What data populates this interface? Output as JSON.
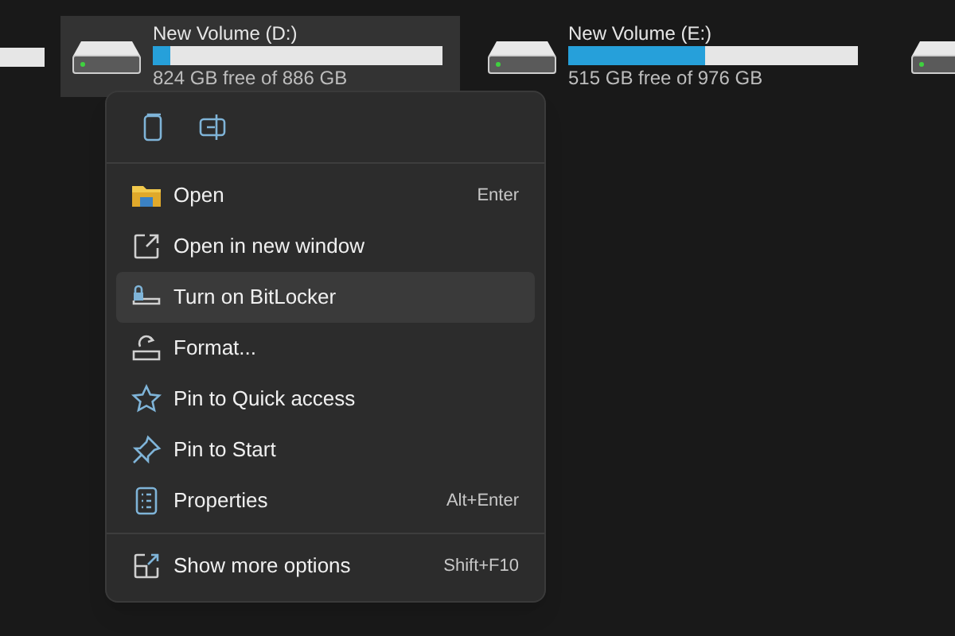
{
  "drives": [
    {
      "name": "New Volume (D:)",
      "free": "824 GB free of 886 GB",
      "level": 0.06,
      "selected": true
    },
    {
      "name": "New Volume (E:)",
      "free": "515 GB free of 976 GB",
      "level": 0.47,
      "selected": false
    }
  ],
  "context_menu": {
    "toolbar": [
      {
        "kind": "copy"
      },
      {
        "kind": "rename"
      }
    ],
    "items": [
      {
        "kind": "folder",
        "label": "Open",
        "shortcut": "Enter",
        "selected": false
      },
      {
        "kind": "new-window",
        "label": "Open in new window",
        "selected": false
      },
      {
        "kind": "lock",
        "label": "Turn on BitLocker",
        "selected": true
      },
      {
        "kind": "format",
        "label": "Format...",
        "selected": false
      },
      {
        "kind": "star",
        "label": "Pin to Quick access",
        "selected": false
      },
      {
        "kind": "pin",
        "label": "Pin to Start",
        "selected": false
      },
      {
        "kind": "properties",
        "label": "Properties",
        "shortcut": "Alt+Enter",
        "selected": false
      },
      {
        "kind": "more",
        "label": "Show more options",
        "shortcut": "Shift+F10",
        "selected": false,
        "divider_before": true
      }
    ]
  }
}
